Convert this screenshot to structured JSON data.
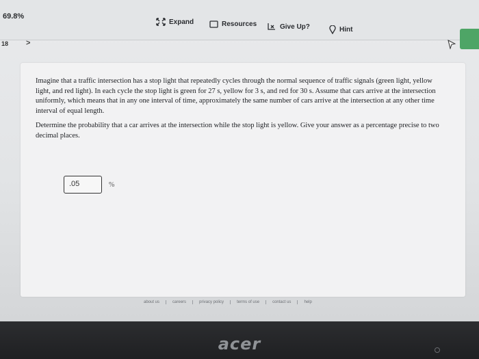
{
  "header": {
    "score": "69.8%",
    "tools": [
      {
        "label": "Expand",
        "icon": "expand-icon"
      },
      {
        "label": "Resources",
        "icon": "resources-icon"
      },
      {
        "label": "Give Up?",
        "icon": "give-up-icon"
      },
      {
        "label": "Hint",
        "icon": "hint-icon"
      }
    ]
  },
  "nav": {
    "question_number": "18",
    "next_symbol": ">"
  },
  "question": {
    "paragraph1": "Imagine that a traffic intersection has a stop light that repeatedly cycles through the normal sequence of traffic signals (green light, yellow light, and red light). In each cycle the stop light is green for 27 s, yellow for 3 s, and red for 30 s. Assume that cars arrive at the intersection uniformly, which means that in any one interval of time, approximately the same number of cars arrive at the intersection at any other time interval of equal length.",
    "paragraph2": "Determine the probability that a car arrives at the intersection while the stop light is yellow. Give your answer as a percentage precise to two decimal places.",
    "answer_value": ".05",
    "unit": "%"
  },
  "footer": {
    "links": [
      "about us",
      "careers",
      "privacy policy",
      "terms of use",
      "contact us",
      "help"
    ]
  },
  "monitor": {
    "brand": "acer"
  },
  "colors": {
    "accent_green": "#4ea566",
    "screen_bg": "#e6e7e9",
    "bezel": "#252628"
  }
}
